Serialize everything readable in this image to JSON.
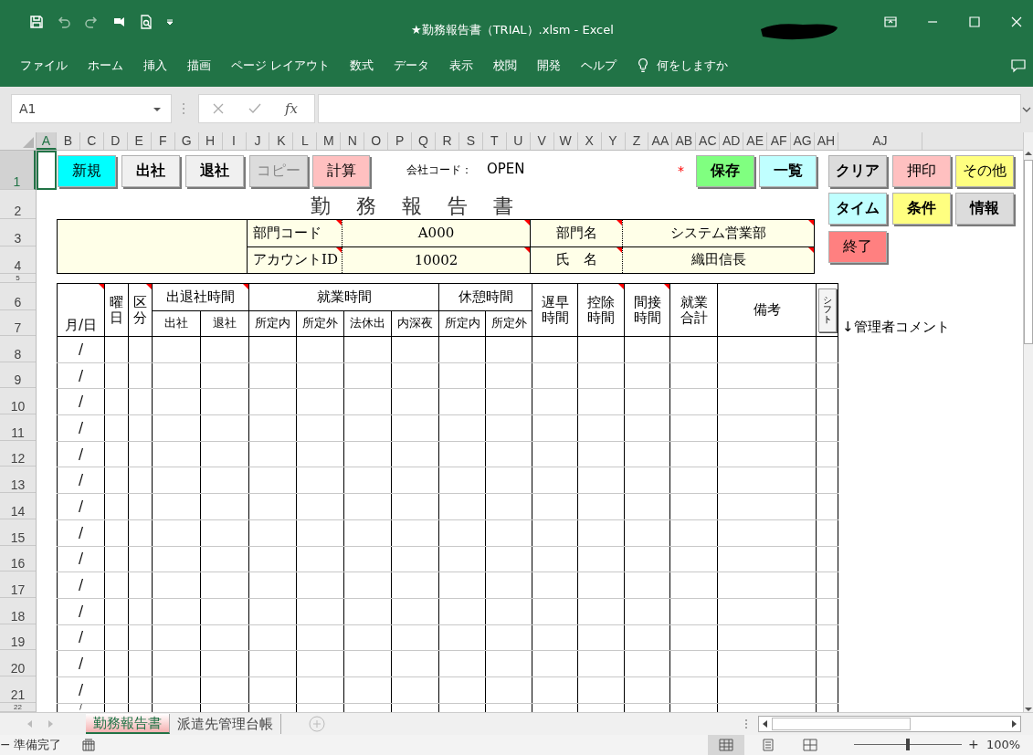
{
  "title_bar": {
    "title": "★勤務報告書（TRIAL）.xlsm - Excel"
  },
  "ribbon_tabs": [
    "ファイル",
    "ホーム",
    "挿入",
    "描画",
    "ページ レイアウト",
    "数式",
    "データ",
    "表示",
    "校閲",
    "開発",
    "ヘルプ"
  ],
  "tell_me": "何をしますか",
  "formula_bar": {
    "name_box": "A1",
    "function_label": "fx"
  },
  "columns": [
    {
      "label": "A",
      "selected": true
    },
    {
      "label": "B",
      "selected": false
    },
    {
      "label": "C",
      "selected": false
    },
    {
      "label": "D",
      "selected": false
    },
    {
      "label": "E",
      "selected": false
    },
    {
      "label": "F",
      "selected": false
    },
    {
      "label": "G",
      "selected": false
    },
    {
      "label": "H",
      "selected": false
    },
    {
      "label": "I",
      "selected": false
    },
    {
      "label": "J",
      "selected": false
    },
    {
      "label": "K",
      "selected": false
    },
    {
      "label": "L",
      "selected": false
    },
    {
      "label": "M",
      "selected": false
    },
    {
      "label": "N",
      "selected": false
    },
    {
      "label": "O",
      "selected": false
    },
    {
      "label": "P",
      "selected": false
    },
    {
      "label": "Q",
      "selected": false
    },
    {
      "label": "R",
      "selected": false
    },
    {
      "label": "S",
      "selected": false
    },
    {
      "label": "T",
      "selected": false
    },
    {
      "label": "U",
      "selected": false
    },
    {
      "label": "V",
      "selected": false
    },
    {
      "label": "W",
      "selected": false
    },
    {
      "label": "X",
      "selected": false
    },
    {
      "label": "Y",
      "selected": false
    },
    {
      "label": "Z",
      "selected": false
    },
    {
      "label": "AA",
      "selected": false
    },
    {
      "label": "AB",
      "selected": false
    },
    {
      "label": "AC",
      "selected": false
    },
    {
      "label": "AD",
      "selected": false
    },
    {
      "label": "AE",
      "selected": false
    },
    {
      "label": "AF",
      "selected": false
    },
    {
      "label": "AG",
      "selected": false
    },
    {
      "label": "AH",
      "selected": false
    },
    {
      "label": "AJ",
      "selected": false
    }
  ],
  "rows": [
    {
      "label": "1",
      "selected": true
    },
    {
      "label": "2",
      "selected": false
    },
    {
      "label": "3",
      "selected": false
    },
    {
      "label": "4",
      "selected": false
    },
    {
      "label": "5",
      "selected": false
    },
    {
      "label": "6",
      "selected": false
    },
    {
      "label": "7",
      "selected": false
    },
    {
      "label": "8",
      "selected": false
    },
    {
      "label": "9",
      "selected": false
    },
    {
      "label": "10",
      "selected": false
    },
    {
      "label": "11",
      "selected": false
    },
    {
      "label": "12",
      "selected": false
    },
    {
      "label": "13",
      "selected": false
    },
    {
      "label": "14",
      "selected": false
    },
    {
      "label": "15",
      "selected": false
    },
    {
      "label": "16",
      "selected": false
    },
    {
      "label": "17",
      "selected": false
    },
    {
      "label": "18",
      "selected": false
    },
    {
      "label": "19",
      "selected": false
    },
    {
      "label": "20",
      "selected": false
    },
    {
      "label": "21",
      "selected": false
    },
    {
      "label": "22",
      "selected": false
    }
  ],
  "buttons": [
    {
      "label": "新規",
      "color": "#00ffff",
      "bold": false,
      "disabled": false
    },
    {
      "label": "出社",
      "color": "#f0f0f0",
      "bold": true,
      "disabled": false
    },
    {
      "label": "退社",
      "color": "#f0f0f0",
      "bold": true,
      "disabled": false
    },
    {
      "label": "コピー",
      "color": "#dcdcdc",
      "bold": false,
      "disabled": true
    },
    {
      "label": "計算",
      "color": "#ffc0c0",
      "bold": false,
      "disabled": false
    },
    {
      "label": "保存",
      "color": "#80ff80",
      "bold": true,
      "disabled": false
    },
    {
      "label": "一覧",
      "color": "#c0ffff",
      "bold": true,
      "disabled": false
    },
    {
      "label": "クリア",
      "color": "#dcdcdc",
      "bold": true,
      "disabled": false
    },
    {
      "label": "押印",
      "color": "#ffc0c0",
      "bold": false,
      "disabled": false
    },
    {
      "label": "その他",
      "color": "#ffff80",
      "bold": false,
      "disabled": false
    },
    {
      "label": "タイム",
      "color": "#c0ffff",
      "bold": true,
      "disabled": false
    },
    {
      "label": "条件",
      "color": "#ffff80",
      "bold": true,
      "disabled": false
    },
    {
      "label": "情報",
      "color": "#dcdcdc",
      "bold": true,
      "disabled": false
    },
    {
      "label": "終了",
      "color": "#ff8080",
      "bold": false,
      "disabled": false
    }
  ],
  "company_code": {
    "label": "会社コード：",
    "value": "OPEN"
  },
  "required_mark": "*",
  "report_title": "勤務報告書",
  "info": [
    {
      "cells": [
        {
          "text": "部門コード",
          "comment": true
        },
        {
          "text": "A000",
          "comment": true
        },
        {
          "text": "部門名",
          "comment": true
        },
        {
          "text": "システム営業部",
          "comment": true
        }
      ]
    },
    {
      "cells": [
        {
          "text": "アカウントID",
          "comment": true
        },
        {
          "text": "10002",
          "comment": true
        },
        {
          "text": "氏　名",
          "comment": true
        },
        {
          "text": "織田信長",
          "comment": true
        }
      ]
    }
  ],
  "header": [
    {
      "kind": "single",
      "text": "月/日",
      "comment": true
    },
    {
      "kind": "single",
      "text": "曜日",
      "comment": false
    },
    {
      "kind": "single",
      "text": "区分",
      "comment": true
    },
    {
      "kind": "group",
      "text": "出退社時間",
      "comment": true,
      "sub": [
        "出社",
        "退社"
      ]
    },
    {
      "kind": "group",
      "text": "就業時間",
      "comment": false,
      "sub": [
        "所定内",
        "所定外",
        "法休出",
        "内深夜"
      ]
    },
    {
      "kind": "group",
      "text": "休憩時間",
      "comment": false,
      "sub": [
        "所定内",
        "所定外"
      ]
    },
    {
      "kind": "single",
      "text": "遅早時間",
      "comment": false
    },
    {
      "kind": "single",
      "text": "控除時間",
      "comment": true
    },
    {
      "kind": "single",
      "text": "間接時間",
      "comment": true
    },
    {
      "kind": "single",
      "text": "就業合計",
      "comment": false
    },
    {
      "kind": "single",
      "text": "備考",
      "comment": false
    },
    {
      "kind": "button",
      "text": "シフト",
      "comment": false
    }
  ],
  "manager_comment": "↓管理者コメント",
  "data_rows": [
    {
      "date": "/"
    },
    {
      "date": "/"
    },
    {
      "date": "/"
    },
    {
      "date": "/"
    },
    {
      "date": "/"
    },
    {
      "date": "/"
    },
    {
      "date": "/"
    },
    {
      "date": "/"
    },
    {
      "date": "/"
    },
    {
      "date": "/"
    },
    {
      "date": "/"
    },
    {
      "date": "/"
    },
    {
      "date": "/"
    },
    {
      "date": "/"
    },
    {
      "date": "/"
    }
  ],
  "sheet_tabs": [
    {
      "label": "勤務報告書",
      "selected": true
    },
    {
      "label": "派遣先管理台帳",
      "selected": false
    }
  ],
  "status_bar": {
    "text": "準備完了",
    "views": [
      {
        "kind": "normal",
        "selected": true
      },
      {
        "kind": "page_layout",
        "selected": false
      },
      {
        "kind": "page_break",
        "selected": false
      }
    ],
    "zoom": {
      "level": 0.5,
      "minus": "−",
      "plus": "+",
      "value": "100%"
    }
  }
}
